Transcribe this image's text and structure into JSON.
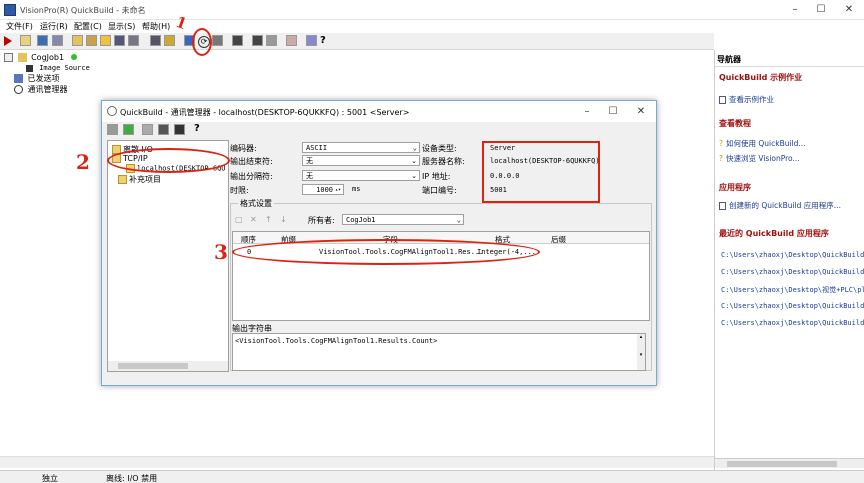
{
  "window": {
    "title": "VisionPro(R) QuickBuild - 未命名"
  },
  "menu": [
    "文件(F)",
    "运行(R)",
    "配置(C)",
    "显示(S)",
    "帮助(H)"
  ],
  "tree": {
    "job": "CogJob1",
    "image_source": "Image Source",
    "sent": "已发送项",
    "comm": "通讯管理器"
  },
  "nav": {
    "header": "导航器",
    "sec1_title": "QuickBuild 示例作业",
    "sec1_link": "查看示例作业",
    "sec2_title": "查看教程",
    "sec2_link1": "如何使用 QuickBuild...",
    "sec2_link2": "快速浏览 VisionPro...",
    "sec3_title": "应用程序",
    "sec3_link": "创建新的 QuickBuild 应用程序...",
    "sec4_title": "最近的 QuickBuild 应用程序",
    "paths": [
      "C:\\Users\\zhaoxj\\Desktop\\QuickBuild_pi",
      "C:\\Users\\zhaoxj\\Desktop\\QuickBuild_me",
      "C:\\Users\\zhaoxj\\Desktop\\视觉+PLC\\plc+",
      "C:\\Users\\zhaoxj\\Desktop\\QuickBuild_pi",
      "C:\\Users\\zhaoxj\\Desktop\\QuickBuild1.vp"
    ]
  },
  "dialog": {
    "title": "QuickBuild - 通讯管理器 - localhost(DESKTOP-6QUKKFQ) : 5001 <Server>",
    "tree": {
      "discrete": "离散 I/O",
      "tcpip": "TCP/IP",
      "host": "localhost(DESKTOP-6QU",
      "supplemental": "补充项目"
    },
    "encoder_label": "编码器:",
    "encoder_value": "ASCII",
    "terminator_label": "输出结束符:",
    "terminator_value": "无",
    "separator_label": "输出分隔符:",
    "separator_value": "无",
    "timeout_label": "时限:",
    "timeout_value": "1000",
    "timeout_unit": "ms",
    "device_type_label": "设备类型:",
    "device_type_value": "Server",
    "server_name_label": "服务器名称:",
    "server_name_value": "localhost(DESKTOP-6QUKKFQ)",
    "ip_label": "IP 地址:",
    "ip_value": "0.0.0.0",
    "port_label": "端口编号:",
    "port_value": "5001",
    "format_group": "格式设置",
    "owner_label": "所有者:",
    "owner_value": "CogJob1",
    "columns": [
      "顺序",
      "前缀",
      "字段",
      "格式",
      "后缀"
    ],
    "row": {
      "order": "0",
      "field": "VisionTool.Tools.CogFMAlignTool1.Res...",
      "format": "Integer(-4,..."
    },
    "output_label": "输出字符串",
    "output_value": "<VisionTool.Tools.CogFMAlignTool1.Results.Count>"
  },
  "status": {
    "left": "独立",
    "right": "离线: I/O 禁用"
  },
  "annotations": {
    "n1": "1",
    "n2": "2",
    "n3": "3"
  },
  "colors": {
    "annotation": "#d21",
    "link": "#1a3d91",
    "section": "#a01010",
    "selection": "#2d5aa0"
  }
}
